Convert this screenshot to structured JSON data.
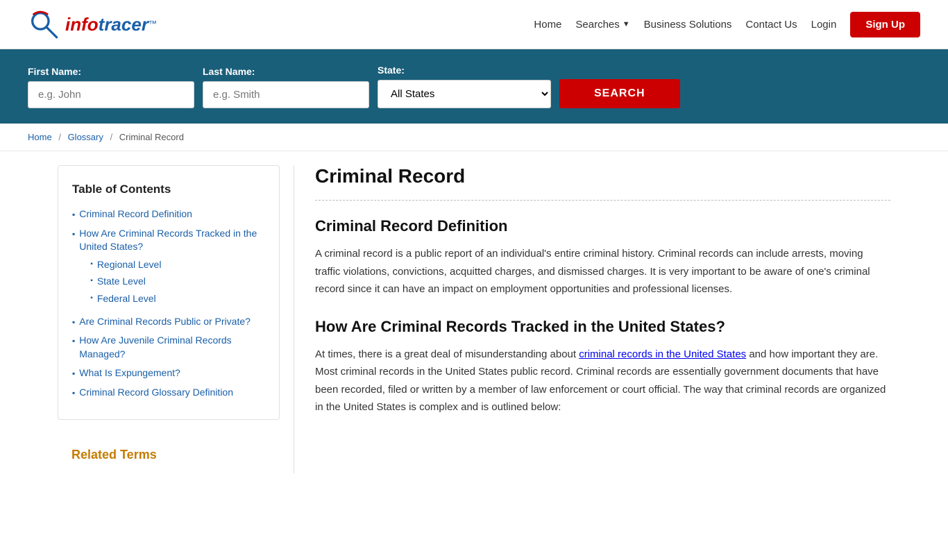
{
  "header": {
    "logo_text_info": "info",
    "logo_text_tracer": "tracer",
    "logo_trademark": "™",
    "nav": {
      "home": "Home",
      "searches": "Searches",
      "searches_chevron": "▼",
      "business_solutions": "Business Solutions",
      "contact_us": "Contact Us",
      "login": "Login",
      "signup": "Sign Up"
    }
  },
  "search_bar": {
    "first_name_label": "First Name:",
    "first_name_placeholder": "e.g. John",
    "last_name_label": "Last Name:",
    "last_name_placeholder": "e.g. Smith",
    "state_label": "State:",
    "state_default": "All States",
    "search_button": "SEARCH"
  },
  "breadcrumb": {
    "home": "Home",
    "sep1": "/",
    "glossary": "Glossary",
    "sep2": "/",
    "current": "Criminal Record"
  },
  "toc": {
    "title": "Table of Contents",
    "items": [
      {
        "label": "Criminal Record Definition",
        "href": "#definition"
      },
      {
        "label": "How Are Criminal Records Tracked in the United States?",
        "href": "#tracked",
        "subitems": [
          {
            "label": "Regional Level",
            "href": "#regional"
          },
          {
            "label": "State Level",
            "href": "#state"
          },
          {
            "label": "Federal Level",
            "href": "#federal"
          }
        ]
      },
      {
        "label": "Are Criminal Records Public or Private?",
        "href": "#public"
      },
      {
        "label": "How Are Juvenile Criminal Records Managed?",
        "href": "#juvenile"
      },
      {
        "label": "What Is Expungement?",
        "href": "#expungement"
      },
      {
        "label": "Criminal Record Glossary Definition",
        "href": "#glossary"
      }
    ]
  },
  "related_terms": {
    "title": "Related Terms"
  },
  "article": {
    "title": "Criminal Record",
    "section1_title": "Criminal Record Definition",
    "section1_text": "A criminal record is a public report of an individual's entire criminal history. Criminal records can include arrests, moving traffic violations, convictions, acquitted charges, and dismissed charges. It is very important to be aware of one's criminal record since it can have an impact on employment opportunities and professional licenses.",
    "section2_title": "How Are Criminal Records Tracked in the United States?",
    "section2_text_before": "At times, there is a great deal of misunderstanding about ",
    "section2_link_text": "criminal records in the United States",
    "section2_link_href": "#",
    "section2_text_after": " and how important they are. Most criminal records in the United States public record. Criminal records are essentially government documents that have been recorded, filed or written by a member of law enforcement or court official. The way that criminal records are organized in the United States is complex and is outlined below:"
  }
}
